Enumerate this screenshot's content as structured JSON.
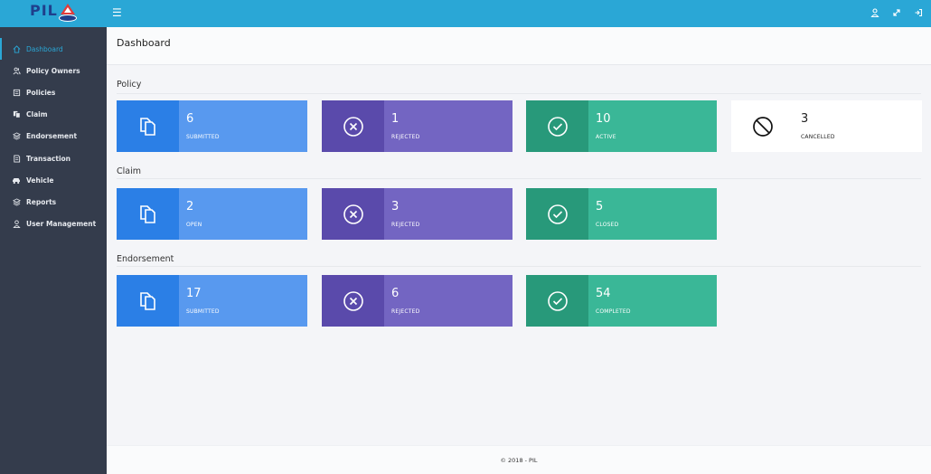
{
  "brand": {
    "logo_text": "PIL"
  },
  "header": {
    "menu_icon": "hamburger-icon",
    "icons": [
      "user-icon",
      "expand-icon",
      "logout-icon"
    ]
  },
  "sidebar": {
    "items": [
      {
        "label": "Dashboard",
        "icon": "home-icon",
        "active": true
      },
      {
        "label": "Policy Owners",
        "icon": "users-icon"
      },
      {
        "label": "Policies",
        "icon": "document-icon"
      },
      {
        "label": "Claim",
        "icon": "files-icon"
      },
      {
        "label": "Endorsement",
        "icon": "layers-icon"
      },
      {
        "label": "Transaction",
        "icon": "card-icon"
      },
      {
        "label": "Vehicle",
        "icon": "car-icon"
      },
      {
        "label": "Reports",
        "icon": "layers-icon"
      },
      {
        "label": "User Management",
        "icon": "user-icon"
      }
    ]
  },
  "page": {
    "title": "Dashboard"
  },
  "sections": {
    "policy": {
      "label": "Policy",
      "cards": [
        {
          "value": "6",
          "label": "SUBMITTED"
        },
        {
          "value": "1",
          "label": "REJECTED"
        },
        {
          "value": "10",
          "label": "ACTIVE"
        },
        {
          "value": "3",
          "label": "CANCELLED"
        }
      ]
    },
    "claim": {
      "label": "Claim",
      "cards": [
        {
          "value": "2",
          "label": "OPEN"
        },
        {
          "value": "3",
          "label": "REJECTED"
        },
        {
          "value": "5",
          "label": "CLOSED"
        }
      ]
    },
    "endorsement": {
      "label": "Endorsement",
      "cards": [
        {
          "value": "17",
          "label": "SUBMITTED"
        },
        {
          "value": "6",
          "label": "REJECTED"
        },
        {
          "value": "54",
          "label": "COMPLETED"
        }
      ]
    }
  },
  "footer": {
    "text": "© 2018 - PIL"
  },
  "colors": {
    "topbar": "#2aa7d6",
    "sidebar": "#343c4c",
    "blue": "#5899ef",
    "purple": "#7365c2",
    "green": "#3ab797"
  }
}
